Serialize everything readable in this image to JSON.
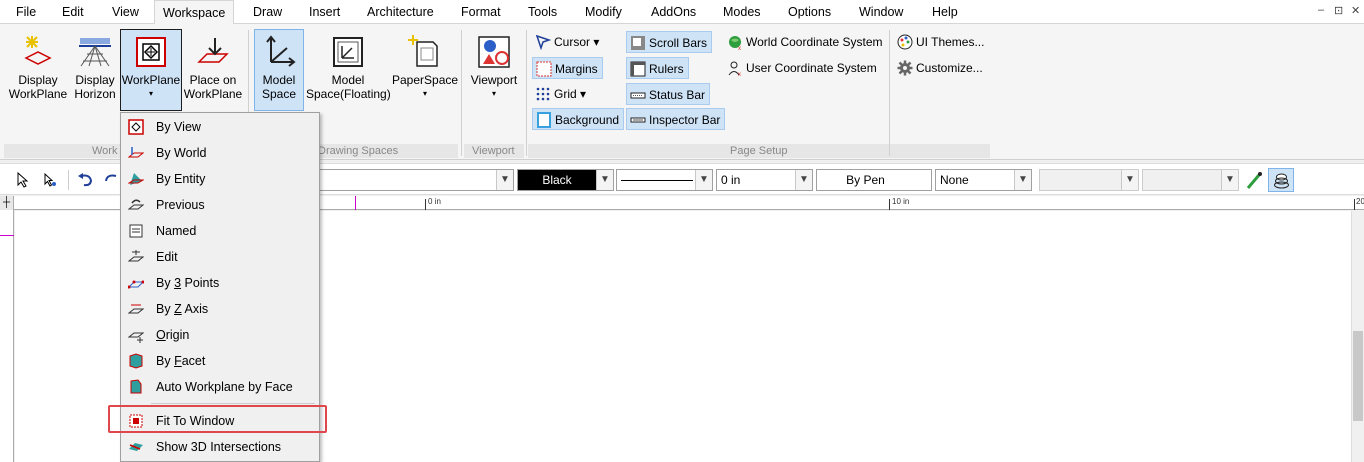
{
  "menubar": {
    "items": [
      "File",
      "Edit",
      "View",
      "Workspace",
      "Draw",
      "Insert",
      "Architecture",
      "Format",
      "Tools",
      "Modify",
      "AddOns",
      "Modes",
      "Options",
      "Window",
      "Help"
    ],
    "window_controls": [
      "–",
      "⊡",
      "✕"
    ]
  },
  "ribbon": {
    "workplane_group": {
      "label": "Work",
      "display_workplane": [
        "Display",
        "WorkPlane"
      ],
      "display_horizon": [
        "Display",
        "Horizon"
      ],
      "workplane": [
        "WorkPlane",
        "▾"
      ],
      "place_on_workplane": [
        "Place on",
        "WorkPlane"
      ]
    },
    "drawing_spaces_group": {
      "label": "Drawing Spaces",
      "model_space": [
        "Model",
        "Space"
      ],
      "model_space_floating": [
        "Model",
        "Space(Floating)"
      ],
      "paper_space": [
        "PaperSpace",
        "▾"
      ]
    },
    "viewport_group": {
      "label": "Viewport",
      "viewport": [
        "Viewport",
        "▾"
      ]
    },
    "page_setup_group": {
      "label": "Page Setup",
      "cursor": "Cursor ▾",
      "margins": "Margins",
      "grid": "Grid ▾",
      "background": "Background",
      "scroll_bars": "Scroll Bars",
      "rulers": "Rulers",
      "status_bar": "Status Bar",
      "inspector_bar": "Inspector Bar",
      "world_cs": "World Coordinate System",
      "user_cs": "User Coordinate System"
    },
    "themes": {
      "ui_themes": "UI Themes...",
      "customize": "Customize..."
    }
  },
  "toolbar": {
    "color_value": "Black",
    "thickness_value": "0 in",
    "pen_value": "By Pen",
    "fill_value": "None"
  },
  "ruler": {
    "labels": [
      "0 in",
      "10 in",
      "20"
    ]
  },
  "dropdown": {
    "items": [
      "By View",
      "By World",
      "By Entity",
      "Previous",
      "Named",
      "Edit",
      "By 3 Points",
      "By Z Axis",
      "Origin",
      "By Facet",
      "Auto Workplane by Face"
    ],
    "items_after_sep": [
      "Fit To Window",
      "Show 3D Intersections"
    ]
  },
  "colors": {
    "highlight": "#cfe3f7",
    "red_box": "#e0474c",
    "accent_blue": "#1f6fd0"
  }
}
